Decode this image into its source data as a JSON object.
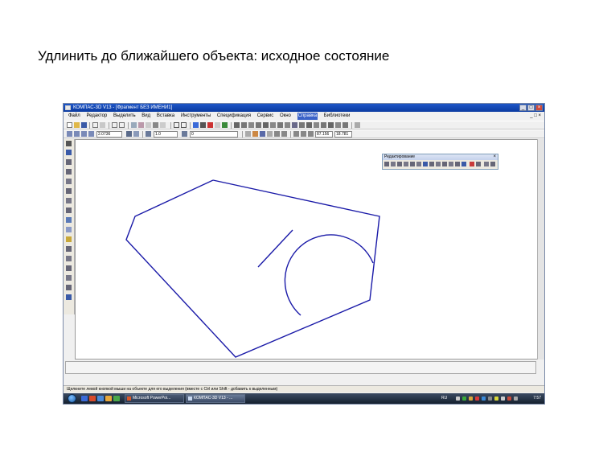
{
  "slide": {
    "title": "Удлинить до  ближайшего объекта: исходное состояние"
  },
  "window": {
    "title": "КОМПАС-3D V13 - [Фрагмент БЕЗ ИМЕНИ1]",
    "controls": {
      "minimize": "_",
      "maximize": "□",
      "close": "×"
    }
  },
  "menu": {
    "items": [
      "Файл",
      "Редактор",
      "Выделить",
      "Вид",
      "Вставка",
      "Инструменты",
      "Спецификация",
      "Сервис",
      "Окно",
      "Справка",
      "Библиотеки"
    ],
    "active_index": 9,
    "mdi_controls": "_ □ ×"
  },
  "toolbar": {
    "zoom_value": "2.0736",
    "step_value": "1.0",
    "layer_value": "0",
    "coord_x": "87.156",
    "coord_y": "18.781"
  },
  "edit_panel": {
    "title": "Редактирование",
    "close": "×"
  },
  "status": {
    "hint": "Щелкните левой кнопкой мыши на объекте для его выделения (вместе с Ctrl или Shift - добавить к выделенным)"
  },
  "taskbar": {
    "buttons": [
      "Microsoft PowerPoi...",
      "КОМПАС-3D V13 - ..."
    ],
    "active_index": 1,
    "lang": "RU",
    "clock": "7:57"
  },
  "colors": {
    "geometry": "#1a1aa8",
    "titlebar": "#1e56c8",
    "taskbar": "#1c2a3c"
  },
  "icons": [
    "windows-start-icon",
    "powerpoint-icon",
    "kompas-icon",
    "pointer-icon",
    "zoom-icon",
    "pan-icon",
    "undo-icon",
    "redo-icon"
  ]
}
